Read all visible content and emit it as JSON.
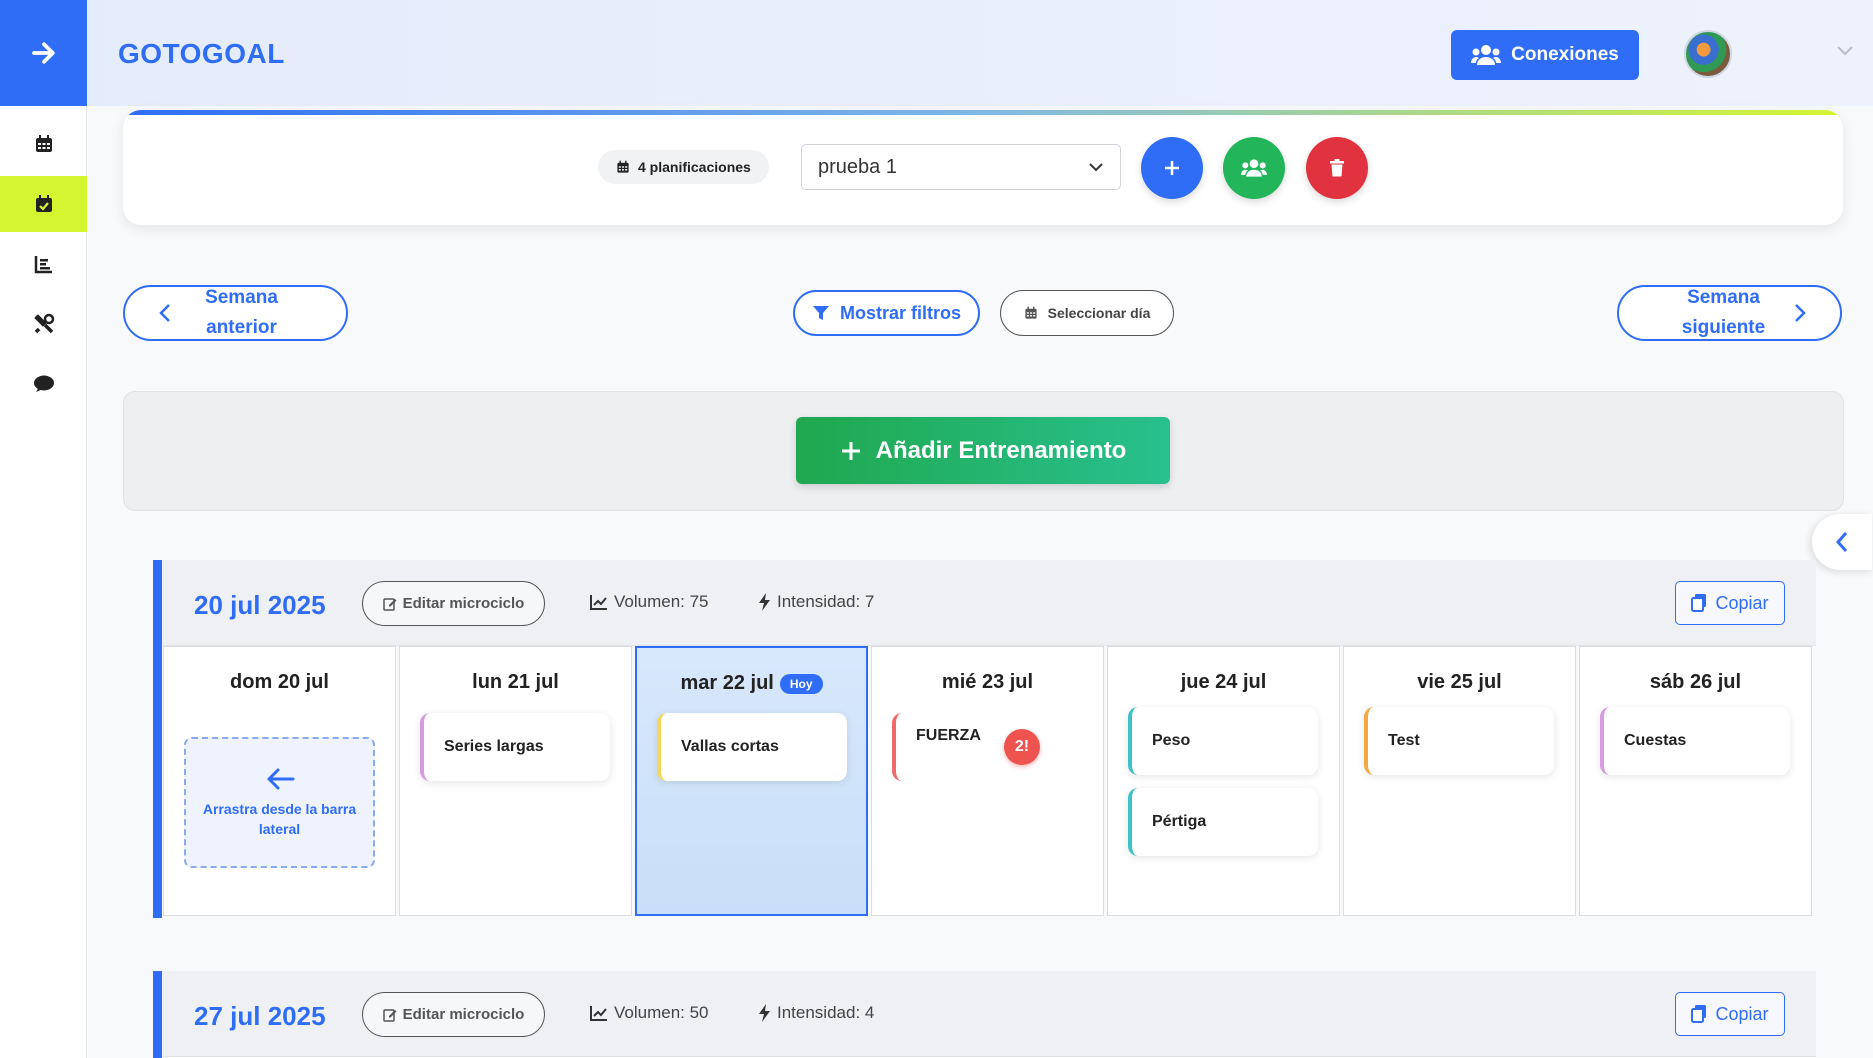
{
  "app": {
    "brand": "GOTOGOAL"
  },
  "header": {
    "connections_label": "Conexiones"
  },
  "planning": {
    "count_label": "4 planificaciones",
    "selected": "prueba 1"
  },
  "nav": {
    "prev_line1": "Semana",
    "prev_line2": "anterior",
    "next_line1": "Semana",
    "next_line2": "siguiente",
    "filters_label": "Mostrar filtros",
    "select_day_label": "Seleccionar día"
  },
  "add_training_label": "Añadir Entrenamiento",
  "weeks": [
    {
      "date": "20 jul 2025",
      "edit_label": "Editar microciclo",
      "volume": "Volumen: 75",
      "intensity": "Intensidad: 7",
      "copy_label": "Copiar",
      "days": [
        {
          "title": "dom 20 jul",
          "drop_text": "Arrastra desde la barra lateral"
        },
        {
          "title": "lun 21 jul",
          "sessions": [
            "Series largas"
          ]
        },
        {
          "title": "mar 22 jul",
          "today_badge": "Hoy",
          "sessions": [
            "Vallas cortas"
          ]
        },
        {
          "title": "mié 23 jul",
          "sessions": [
            "FUERZA"
          ],
          "badge": "2!"
        },
        {
          "title": "jue 24 jul",
          "sessions": [
            "Peso",
            "Pértiga"
          ]
        },
        {
          "title": "vie 25 jul",
          "sessions": [
            "Test"
          ]
        },
        {
          "title": "sáb 26 jul",
          "sessions": [
            "Cuestas"
          ]
        }
      ]
    },
    {
      "date": "27 jul 2025",
      "edit_label": "Editar microciclo",
      "volume": "Volumen: 50",
      "intensity": "Intensidad: 4",
      "copy_label": "Copiar"
    }
  ],
  "colors": {
    "primary": "#2f6df6",
    "active_nav": "#d6f531",
    "success": "#22b55a",
    "danger": "#e0323f",
    "session_pink": "#d79be0",
    "session_yellow": "#f5d65a",
    "session_red": "#f06a6a",
    "session_teal": "#3fc1c9",
    "session_orange": "#f5a742"
  }
}
